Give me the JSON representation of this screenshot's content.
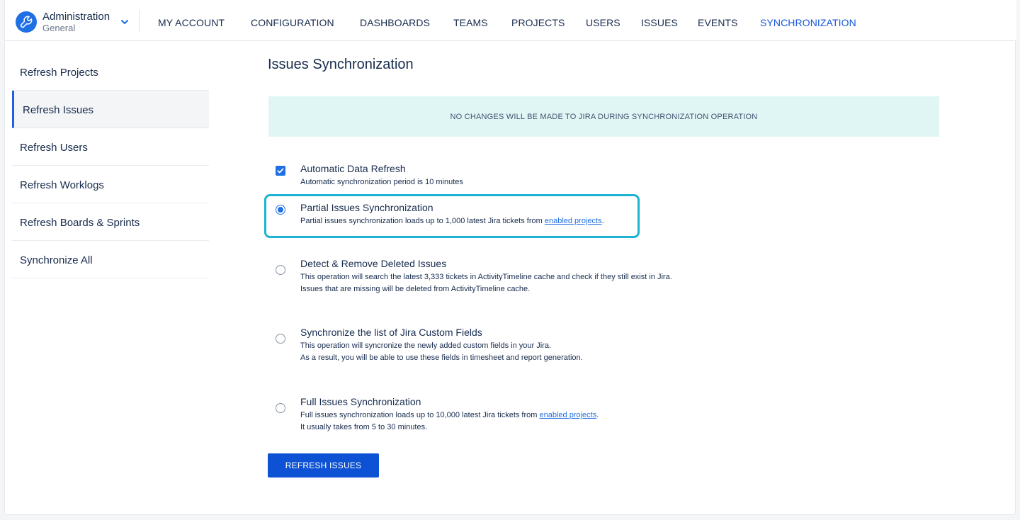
{
  "app": {
    "title": "Administration",
    "subtitle": "General",
    "accent_color": "#1f6fe5"
  },
  "nav": {
    "items": [
      {
        "label": "MY ACCOUNT"
      },
      {
        "label": "CONFIGURATION"
      },
      {
        "label": "DASHBOARDS"
      },
      {
        "label": "TEAMS"
      },
      {
        "label": "PROJECTS"
      },
      {
        "label": "USERS"
      },
      {
        "label": "ISSUES"
      },
      {
        "label": "EVENTS"
      },
      {
        "label": "SYNCHRONIZATION"
      }
    ],
    "active": "SYNCHRONIZATION"
  },
  "sidebar": {
    "items": [
      {
        "label": "Refresh Projects"
      },
      {
        "label": "Refresh Issues"
      },
      {
        "label": "Refresh Users"
      },
      {
        "label": "Refresh Worklogs"
      },
      {
        "label": "Refresh Boards & Sprints"
      },
      {
        "label": "Synchronize All"
      }
    ],
    "active": "Refresh Issues"
  },
  "main": {
    "title": "Issues Synchronization",
    "banner": "NO CHANGES WILL BE MADE TO JIRA DURING SYNCHRONIZATION OPERATION",
    "options": {
      "auto_refresh": {
        "title": "Automatic Data Refresh",
        "desc": "Automatic synchronization period is 10 minutes",
        "checked": true
      },
      "partial": {
        "title": "Partial Issues Synchronization",
        "desc": "Partial issues synchronization loads up to 1,000 latest Jira tickets from ",
        "link": "enabled projects",
        "after": ".",
        "selected": true
      },
      "detect_remove": {
        "title": "Detect & Remove Deleted Issues",
        "desc1": "This operation will search the latest 3,333 tickets in ActivityTimeline cache and check if they still exist in Jira.",
        "desc2": "Issues that are missing will be deleted from ActivityTimeline cache."
      },
      "custom_fields": {
        "title": "Synchronize the list of Jira Custom Fields",
        "desc1": "This operation will syncronize the newly added custom fields in your Jira.",
        "desc2": "As a result, you will be able to use these fields in timesheet and report generation."
      },
      "full": {
        "title": "Full Issues Synchronization",
        "desc1": "Full issues synchronization loads up to 10,000 latest Jira tickets from ",
        "link": "enabled projects",
        "after": ".",
        "desc2": "It usually takes from 5 to 30 minutes."
      }
    },
    "button": "REFRESH ISSUES"
  }
}
